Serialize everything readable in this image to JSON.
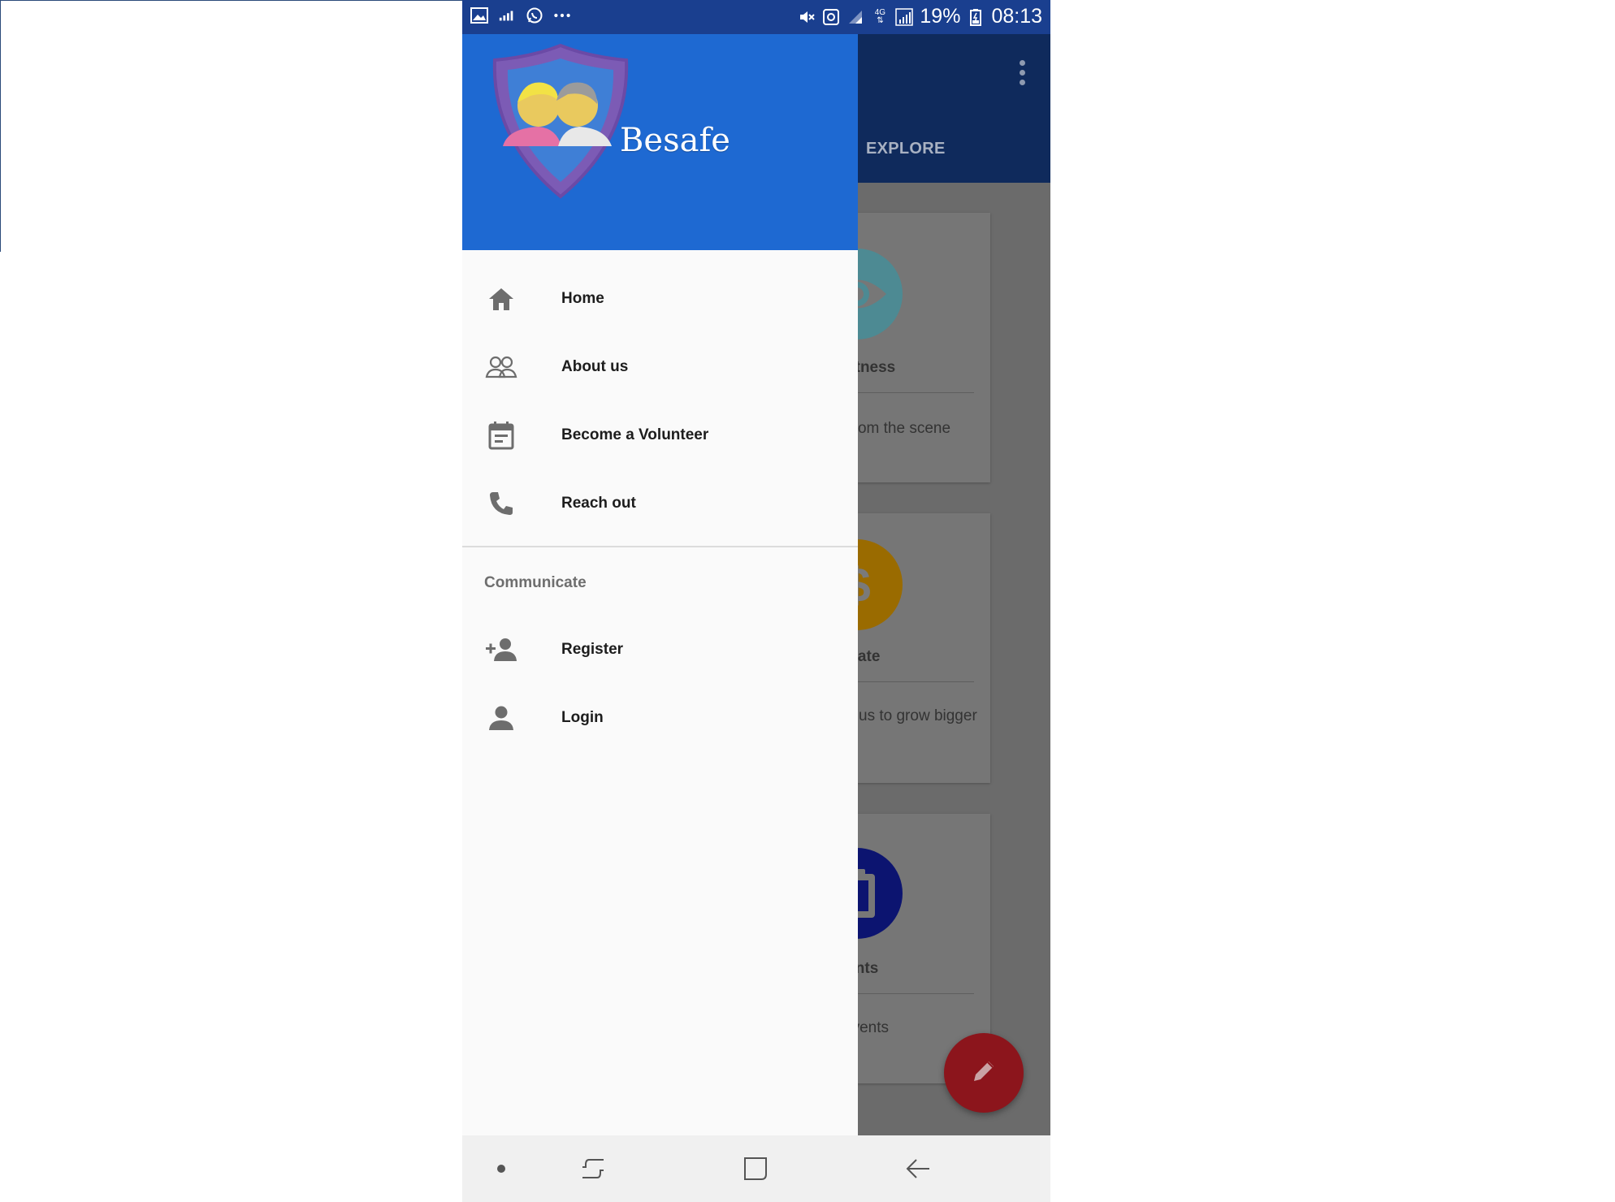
{
  "status_bar": {
    "battery_percent": "19%",
    "time": "08:13",
    "network_label": "4G"
  },
  "background_app": {
    "tab_label": "EXPLORE",
    "cards": [
      {
        "title": "eWitness",
        "desc": "es from the scene",
        "icon": "eye-icon",
        "color": "#4d8a93"
      },
      {
        "title": "Donate",
        "desc": "port us to grow bigger",
        "icon": "dollar-icon",
        "color": "#9a6b00"
      },
      {
        "title": "Events",
        "desc": "w events",
        "icon": "clipboard-icon",
        "color": "#0c1470"
      }
    ],
    "fab_color": "#8c151c"
  },
  "drawer": {
    "brand": "Besafe",
    "header_color": "#1e69d2",
    "items": [
      {
        "label": "Home",
        "icon": "home-icon"
      },
      {
        "label": "About us",
        "icon": "people-icon"
      },
      {
        "label": "Become a Volunteer",
        "icon": "calendar-icon"
      },
      {
        "label": "Reach out",
        "icon": "phone-icon"
      }
    ],
    "section_title": "Communicate",
    "section_items": [
      {
        "label": "Register",
        "icon": "add-person-icon"
      },
      {
        "label": "Login",
        "icon": "person-icon"
      }
    ]
  },
  "nav_bar": {
    "buttons": [
      "dot-icon",
      "recents-icon",
      "overview-icon",
      "back-icon"
    ]
  }
}
